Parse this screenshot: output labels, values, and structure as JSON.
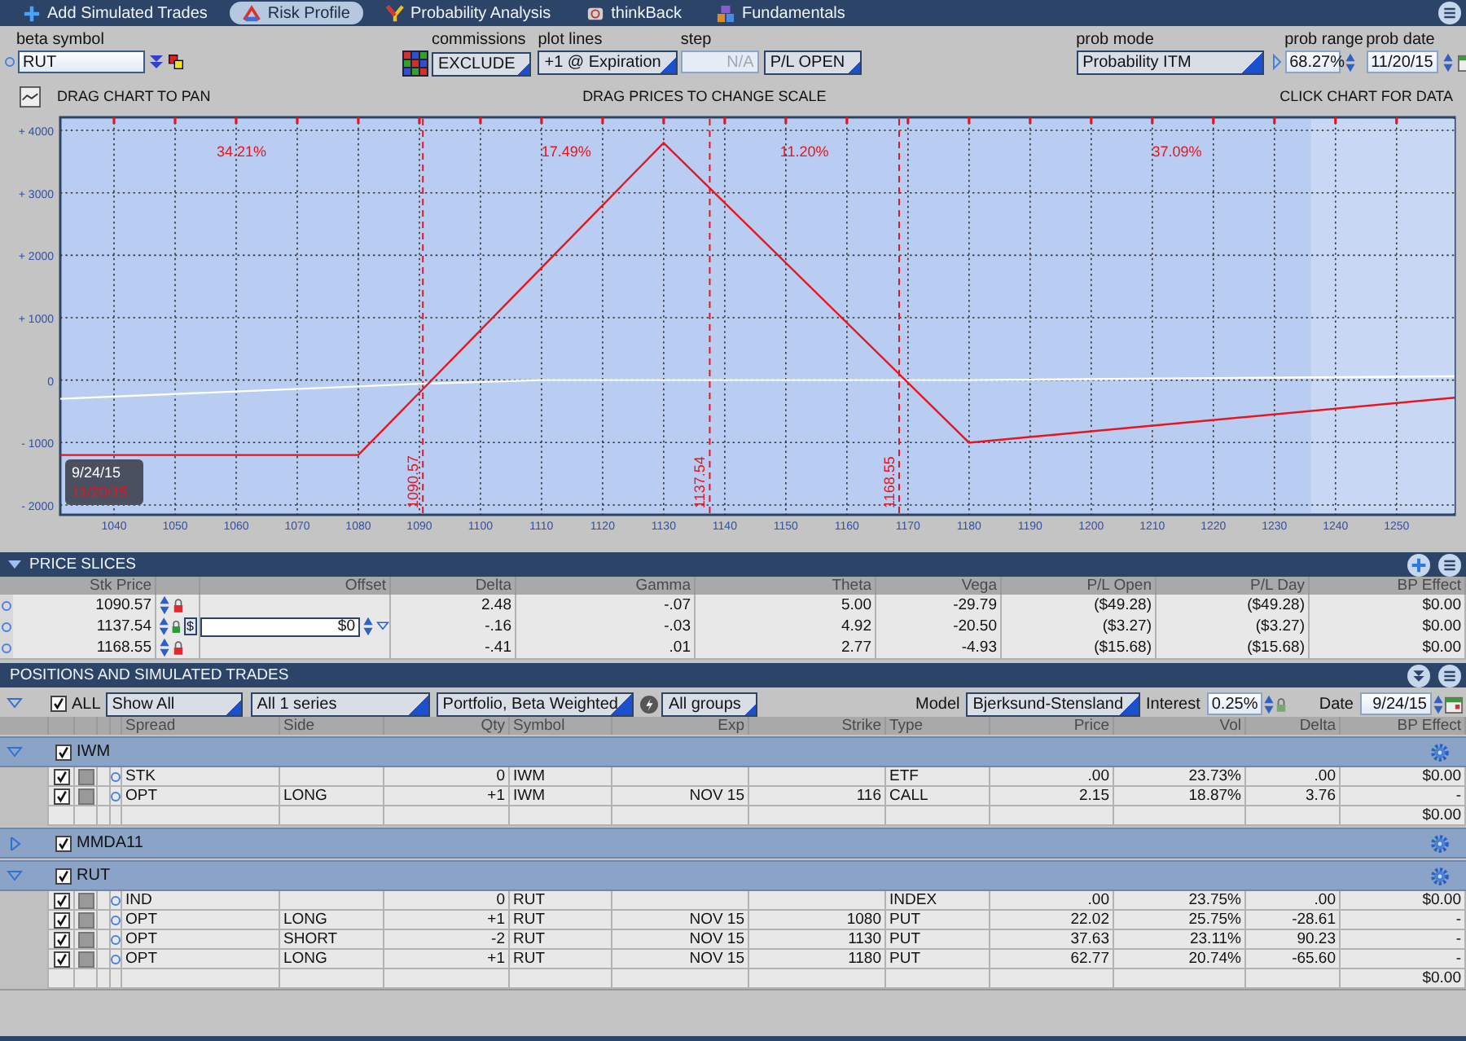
{
  "tabs": [
    {
      "label": "Add Simulated Trades",
      "selected": false
    },
    {
      "label": "Risk Profile",
      "selected": true
    },
    {
      "label": "Probability Analysis",
      "selected": false
    },
    {
      "label": "thinkBack",
      "selected": false
    },
    {
      "label": "Fundamentals",
      "selected": false
    }
  ],
  "controls": {
    "beta_symbol": {
      "label": "beta symbol",
      "value": "RUT"
    },
    "commissions": {
      "label": "commissions",
      "value": "EXCLUDE"
    },
    "plot_lines": {
      "label": "plot lines",
      "value": "+1 @ Expiration"
    },
    "step": {
      "label": "step",
      "value": "N/A",
      "disabled": true
    },
    "plot_mode": {
      "value": "P/L OPEN"
    },
    "prob_mode": {
      "label": "prob mode",
      "value": "Probability ITM"
    },
    "prob_range": {
      "label": "prob range",
      "value": "68.27%"
    },
    "prob_date": {
      "label": "prob date",
      "value": "11/20/15"
    }
  },
  "chart_header": {
    "left": "DRAG CHART TO PAN",
    "center": "DRAG PRICES TO CHANGE SCALE",
    "right": "CLICK CHART FOR DATA"
  },
  "chart": {
    "chart_data": {
      "type": "line",
      "x": [
        1031.2,
        1080,
        1090,
        1110,
        1130,
        1180,
        1259.5
      ],
      "series": [
        {
          "name": "9/24/15",
          "color": "#ffffff",
          "values": [
            -300,
            -100,
            -60,
            0,
            0,
            0,
            60
          ]
        },
        {
          "name": "11/20/15",
          "color": "#e8141e",
          "values": [
            -1200,
            -1200,
            -200,
            1800,
            3800,
            -1000,
            -280
          ]
        }
      ],
      "xlim": [
        1031.2,
        1259.5
      ],
      "ylim": [
        -2157,
        4209
      ],
      "xticks": [
        1040,
        1050,
        1060,
        1070,
        1080,
        1090,
        1100,
        1110,
        1120,
        1130,
        1140,
        1150,
        1160,
        1170,
        1180,
        1190,
        1200,
        1210,
        1220,
        1230,
        1240,
        1250
      ],
      "yticks": [
        {
          "value": 4000,
          "label": "+ 4000"
        },
        {
          "value": 3000,
          "label": "+ 3000"
        },
        {
          "value": 2000,
          "label": "+ 2000"
        },
        {
          "value": 1000,
          "label": "+ 1000"
        },
        {
          "value": 0,
          "label": "0"
        },
        {
          "value": -1000,
          "label": "- 1000"
        },
        {
          "value": -2000,
          "label": "- 2000"
        }
      ],
      "grid": true,
      "annotations": [
        "34.21%",
        "17.49%",
        "11.20%",
        "37.09%"
      ],
      "ref_lines": [
        {
          "axis": "x",
          "value": 1090.57,
          "label": "1090.57"
        },
        {
          "axis": "x",
          "value": 1137.54,
          "label": "1137.54"
        },
        {
          "axis": "x",
          "value": 1168.55,
          "label": "1168.55"
        }
      ]
    }
  },
  "price_slices": {
    "title": "PRICE SLICES",
    "columns": [
      "Stk Price",
      "Offset",
      "Delta",
      "Gamma",
      "Theta",
      "Vega",
      "P/L Open",
      "P/L Day",
      "BP Effect"
    ],
    "rows": [
      {
        "stk_price": "1090.57",
        "locked": false,
        "delta": "2.48",
        "gamma": "-.07",
        "theta": "5.00",
        "vega": "-29.79",
        "pl_open": "($49.28)",
        "pl_day": "($49.28)",
        "bp_effect": "$0.00"
      },
      {
        "stk_price": "1137.54",
        "locked": true,
        "currency": "$",
        "offset": "$0",
        "delta": "-.16",
        "gamma": "-.03",
        "theta": "4.92",
        "vega": "-20.50",
        "pl_open": "($3.27)",
        "pl_day": "($3.27)",
        "bp_effect": "$0.00"
      },
      {
        "stk_price": "1168.55",
        "locked": false,
        "delta": "-.41",
        "gamma": ".01",
        "theta": "2.77",
        "vega": "-4.93",
        "pl_open": "($15.68)",
        "pl_day": "($15.68)",
        "bp_effect": "$0.00"
      }
    ]
  },
  "positions": {
    "title": "POSITIONS AND SIMULATED TRADES",
    "filter": {
      "all_checked": true,
      "all_label": "ALL",
      "show": "Show All",
      "series": "All 1 series",
      "weighting": "Portfolio, Beta Weighted",
      "groups": "All groups",
      "model_label": "Model",
      "model": "Bjerksund-Stensland",
      "interest_label": "Interest",
      "interest": "0.25%",
      "date_label": "Date",
      "date": "9/24/15"
    },
    "columns": [
      "Spread",
      "Side",
      "Qty",
      "Symbol",
      "Exp",
      "Strike",
      "Type",
      "Price",
      "Vol",
      "Delta",
      "BP Effect"
    ],
    "groups": [
      {
        "name": "IWM",
        "checked": true,
        "expanded": true,
        "total": "$0.00",
        "rows": [
          {
            "checked": true,
            "spread": "STK",
            "qty": "0",
            "symbol": "IWM",
            "type": "ETF",
            "price": ".00",
            "vol": "23.73%",
            "delta": ".00",
            "bp_effect": "$0.00"
          },
          {
            "checked": true,
            "spread": "OPT",
            "side": "LONG",
            "qty": "+1",
            "symbol": "IWM",
            "exp": "NOV 15",
            "strike": "116",
            "type": "CALL",
            "price": "2.15",
            "vol": "18.87%",
            "delta": "3.76",
            "bp_effect": "-"
          }
        ]
      },
      {
        "name": "MMDA11",
        "checked": true,
        "expanded": false
      },
      {
        "name": "RUT",
        "checked": true,
        "expanded": true,
        "total": "$0.00",
        "rows": [
          {
            "checked": true,
            "spread": "IND",
            "qty": "0",
            "symbol": "RUT",
            "type": "INDEX",
            "price": ".00",
            "vol": "23.75%",
            "delta": ".00",
            "bp_effect": "$0.00"
          },
          {
            "checked": true,
            "spread": "OPT",
            "side": "LONG",
            "qty": "+1",
            "symbol": "RUT",
            "exp": "NOV 15",
            "strike": "1080",
            "type": "PUT",
            "price": "22.02",
            "vol": "25.75%",
            "delta": "-28.61",
            "bp_effect": "-"
          },
          {
            "checked": true,
            "spread": "OPT",
            "side": "SHORT",
            "qty": "-2",
            "symbol": "RUT",
            "exp": "NOV 15",
            "strike": "1130",
            "type": "PUT",
            "price": "37.63",
            "vol": "23.11%",
            "delta": "90.23",
            "bp_effect": "-"
          },
          {
            "checked": true,
            "spread": "OPT",
            "side": "LONG",
            "qty": "+1",
            "symbol": "RUT",
            "exp": "NOV 15",
            "strike": "1180",
            "type": "PUT",
            "price": "62.77",
            "vol": "20.74%",
            "delta": "-65.60",
            "bp_effect": "-"
          }
        ]
      }
    ]
  }
}
